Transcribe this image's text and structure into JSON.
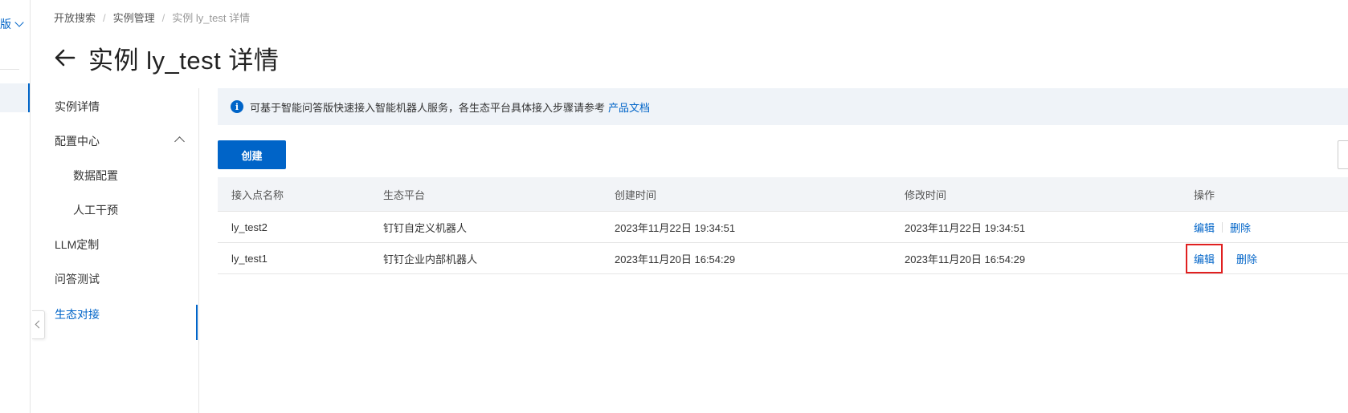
{
  "left_rail": {
    "version_label": "版"
  },
  "breadcrumb": [
    "开放搜索",
    "实例管理",
    "实例 ly_test 详情"
  ],
  "page_title": "实例 ly_test 详情",
  "sidebar": {
    "items": [
      {
        "label": "实例详情"
      },
      {
        "label": "配置中心"
      },
      {
        "label": "数据配置"
      },
      {
        "label": "人工干预"
      },
      {
        "label": "LLM定制"
      },
      {
        "label": "问答测试"
      },
      {
        "label": "生态对接"
      }
    ]
  },
  "banner": {
    "text": "可基于智能问答版快速接入智能机器人服务，各生态平台具体接入步骤请参考",
    "link": "产品文档"
  },
  "toolbar": {
    "create_label": "创建"
  },
  "table": {
    "columns": [
      "接入点名称",
      "生态平台",
      "创建时间",
      "修改时间",
      "操作"
    ],
    "rows": [
      {
        "name": "ly_test2",
        "platform": "钉钉自定义机器人",
        "created": "2023年11月22日 19:34:51",
        "modified": "2023年11月22日 19:34:51"
      },
      {
        "name": "ly_test1",
        "platform": "钉钉企业内部机器人",
        "created": "2023年11月20日 16:54:29",
        "modified": "2023年11月20日 16:54:29"
      }
    ],
    "actions": {
      "edit": "编辑",
      "delete": "删除"
    }
  },
  "colors": {
    "accent": "#0064c8",
    "highlight": "#e02020",
    "banner_bg": "#eff3f8"
  },
  "icons": {
    "back": "arrow-left-icon",
    "info": "info-circle-icon"
  }
}
